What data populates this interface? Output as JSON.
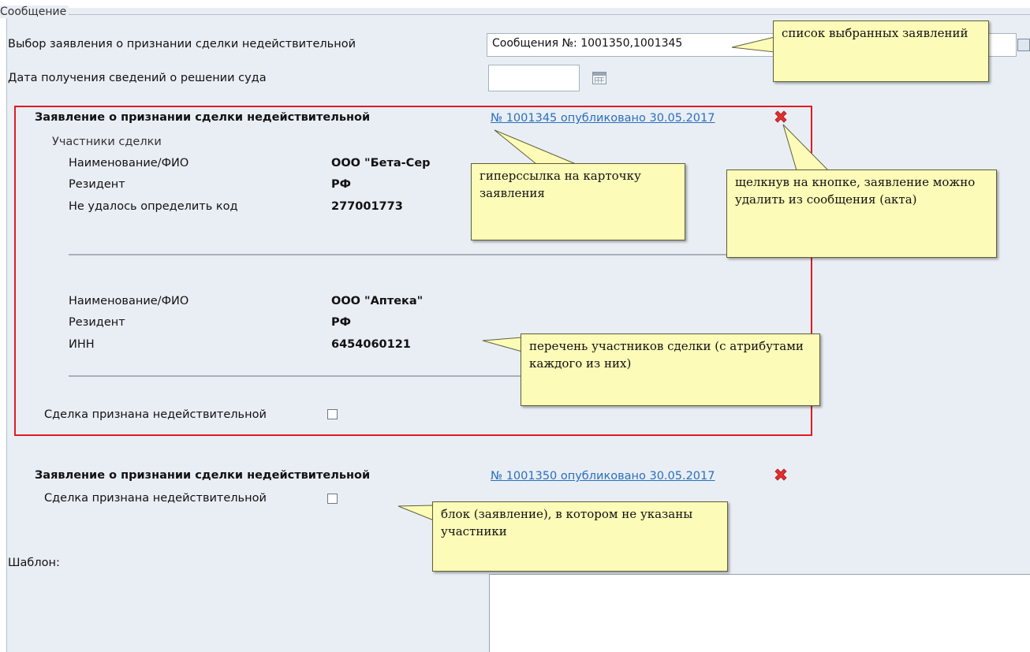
{
  "fieldset": {
    "legend": "Сообщение"
  },
  "form": {
    "statement_select_label": "Выбор заявления о признании сделки недействительной",
    "statement_select_value": "Сообщения №: 1001350,1001345",
    "court_date_label": "Дата получения сведений о решении суда",
    "court_date_value": "",
    "template_label": "Шаблон:",
    "template_value": ""
  },
  "blocks": [
    {
      "title": "Заявление о признании сделки недействительной",
      "link": "№ 1001345 опубликовано 30.05.2017",
      "participants_header": "Участники сделки",
      "participants": [
        {
          "rows": [
            {
              "label": "Наименование/ФИО",
              "value": "ООО \"Бета-Сер"
            },
            {
              "label": "Резидент",
              "value": "РФ"
            },
            {
              "label": "Не удалось определить код",
              "value": "277001773"
            }
          ]
        },
        {
          "rows": [
            {
              "label": "Наименование/ФИО",
              "value": "ООО \"Аптека\""
            },
            {
              "label": "Резидент",
              "value": "РФ"
            },
            {
              "label": "ИНН",
              "value": "6454060121"
            }
          ]
        }
      ],
      "invalid_label": "Сделка признана недействительной",
      "invalid_checked": false
    },
    {
      "title": "Заявление о признании сделки недействительной",
      "link": "№ 1001350 опубликовано 30.05.2017",
      "invalid_label": "Сделка признана недействительной",
      "invalid_checked": false
    }
  ],
  "callouts": {
    "selected_list": "список выбранных заявлений",
    "hyperlink": "гиперссылка на карточку заявления",
    "delete_button": "щелкнув на кнопке, заявление можно удалить из сообщения (акта)",
    "participants_list": "перечень участников сделки (с атрибутами каждого из них)",
    "no_participants": "блок (заявление), в котором не указаны участники"
  },
  "icons": {
    "delete": "close-x-icon",
    "calendar": "calendar-icon",
    "lookup": "lookup-icon"
  },
  "colors": {
    "delete_icon": "#e0312f",
    "link": "#2a6fbd",
    "block_border": "#e01b24",
    "callout_bg": "#fdfbb8"
  }
}
